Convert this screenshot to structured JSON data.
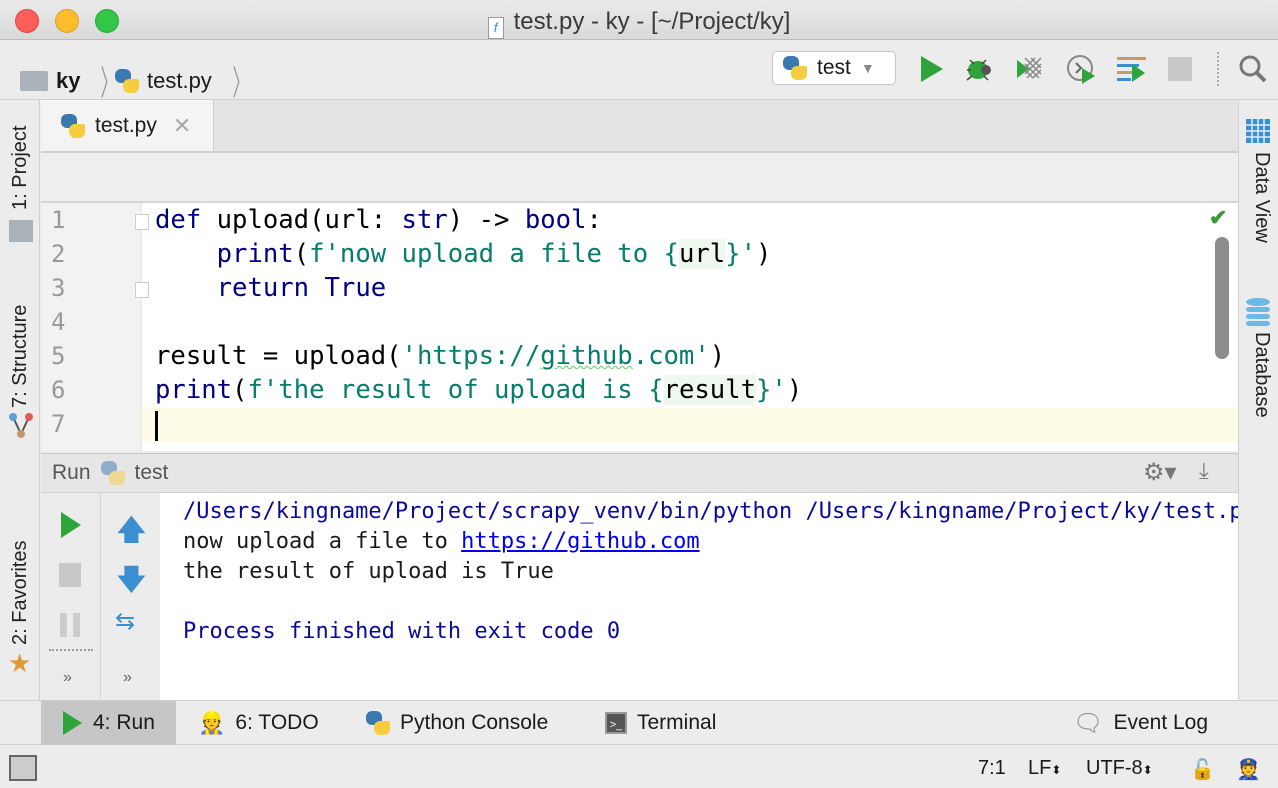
{
  "window": {
    "title": "test.py - ky - [~/Project/ky]",
    "file_icon_glyph": "f"
  },
  "navbar": {
    "breadcrumb": [
      "ky",
      "test.py"
    ],
    "run_config": "test"
  },
  "colors": {
    "close": "#fc5f57",
    "minimize": "#fdbc2e",
    "zoom": "#33c748",
    "run_green": "#2fa43a",
    "keyword": "#000080",
    "string": "#067d6a"
  },
  "left_strip": {
    "project": "1: Project",
    "structure": "7: Structure",
    "favorites": "2: Favorites"
  },
  "right_strip": {
    "data_view": "Data View",
    "database": "Database"
  },
  "editor": {
    "tab": "test.py",
    "line_numbers": [
      "1",
      "2",
      "3",
      "4",
      "5",
      "6",
      "7"
    ],
    "lines": [
      [
        [
          "def ",
          "k"
        ],
        [
          "upload(url: ",
          ""
        ],
        [
          "str",
          "k"
        ],
        [
          ") -> ",
          ""
        ],
        [
          "bool",
          "k"
        ],
        [
          ":",
          ""
        ]
      ],
      [
        [
          "    ",
          ""
        ],
        [
          "print",
          "b"
        ],
        [
          "(",
          ""
        ],
        [
          "f'now upload a file to ",
          "s"
        ],
        [
          "{",
          "s"
        ],
        [
          "url",
          "i"
        ],
        [
          "}",
          "s"
        ],
        [
          "'",
          "s"
        ],
        [
          ")",
          ""
        ]
      ],
      [
        [
          "    ",
          ""
        ],
        [
          "return True",
          "k"
        ]
      ],
      [],
      [
        [
          "result = upload(",
          ""
        ],
        [
          "'https://",
          "s"
        ],
        [
          "github",
          "su"
        ],
        [
          ".com'",
          "s"
        ],
        [
          ")",
          ""
        ]
      ],
      [
        [
          "print",
          "b"
        ],
        [
          "(",
          ""
        ],
        [
          "f'the result of upload is ",
          "s"
        ],
        [
          "{",
          "s"
        ],
        [
          "result",
          "i"
        ],
        [
          "}",
          "s"
        ],
        [
          "'",
          "s"
        ],
        [
          ")",
          ""
        ]
      ],
      []
    ]
  },
  "run_panel": {
    "label": "Run",
    "config": "test",
    "output": {
      "cmd": "/Users/kingname/Project/scrapy_venv/bin/python /Users/kingname/Project/ky/test.py",
      "line2_prefix": "now upload a file to ",
      "line2_link": "https://github.com",
      "line3": "the result of upload is True",
      "exit": "Process finished with exit code 0"
    }
  },
  "bottom_tabs": {
    "run": "4: Run",
    "todo": "6: TODO",
    "console": "Python Console",
    "terminal": "Terminal",
    "event_log": "Event Log"
  },
  "status": {
    "position": "7:1",
    "line_sep": "LF",
    "encoding": "UTF-8"
  }
}
